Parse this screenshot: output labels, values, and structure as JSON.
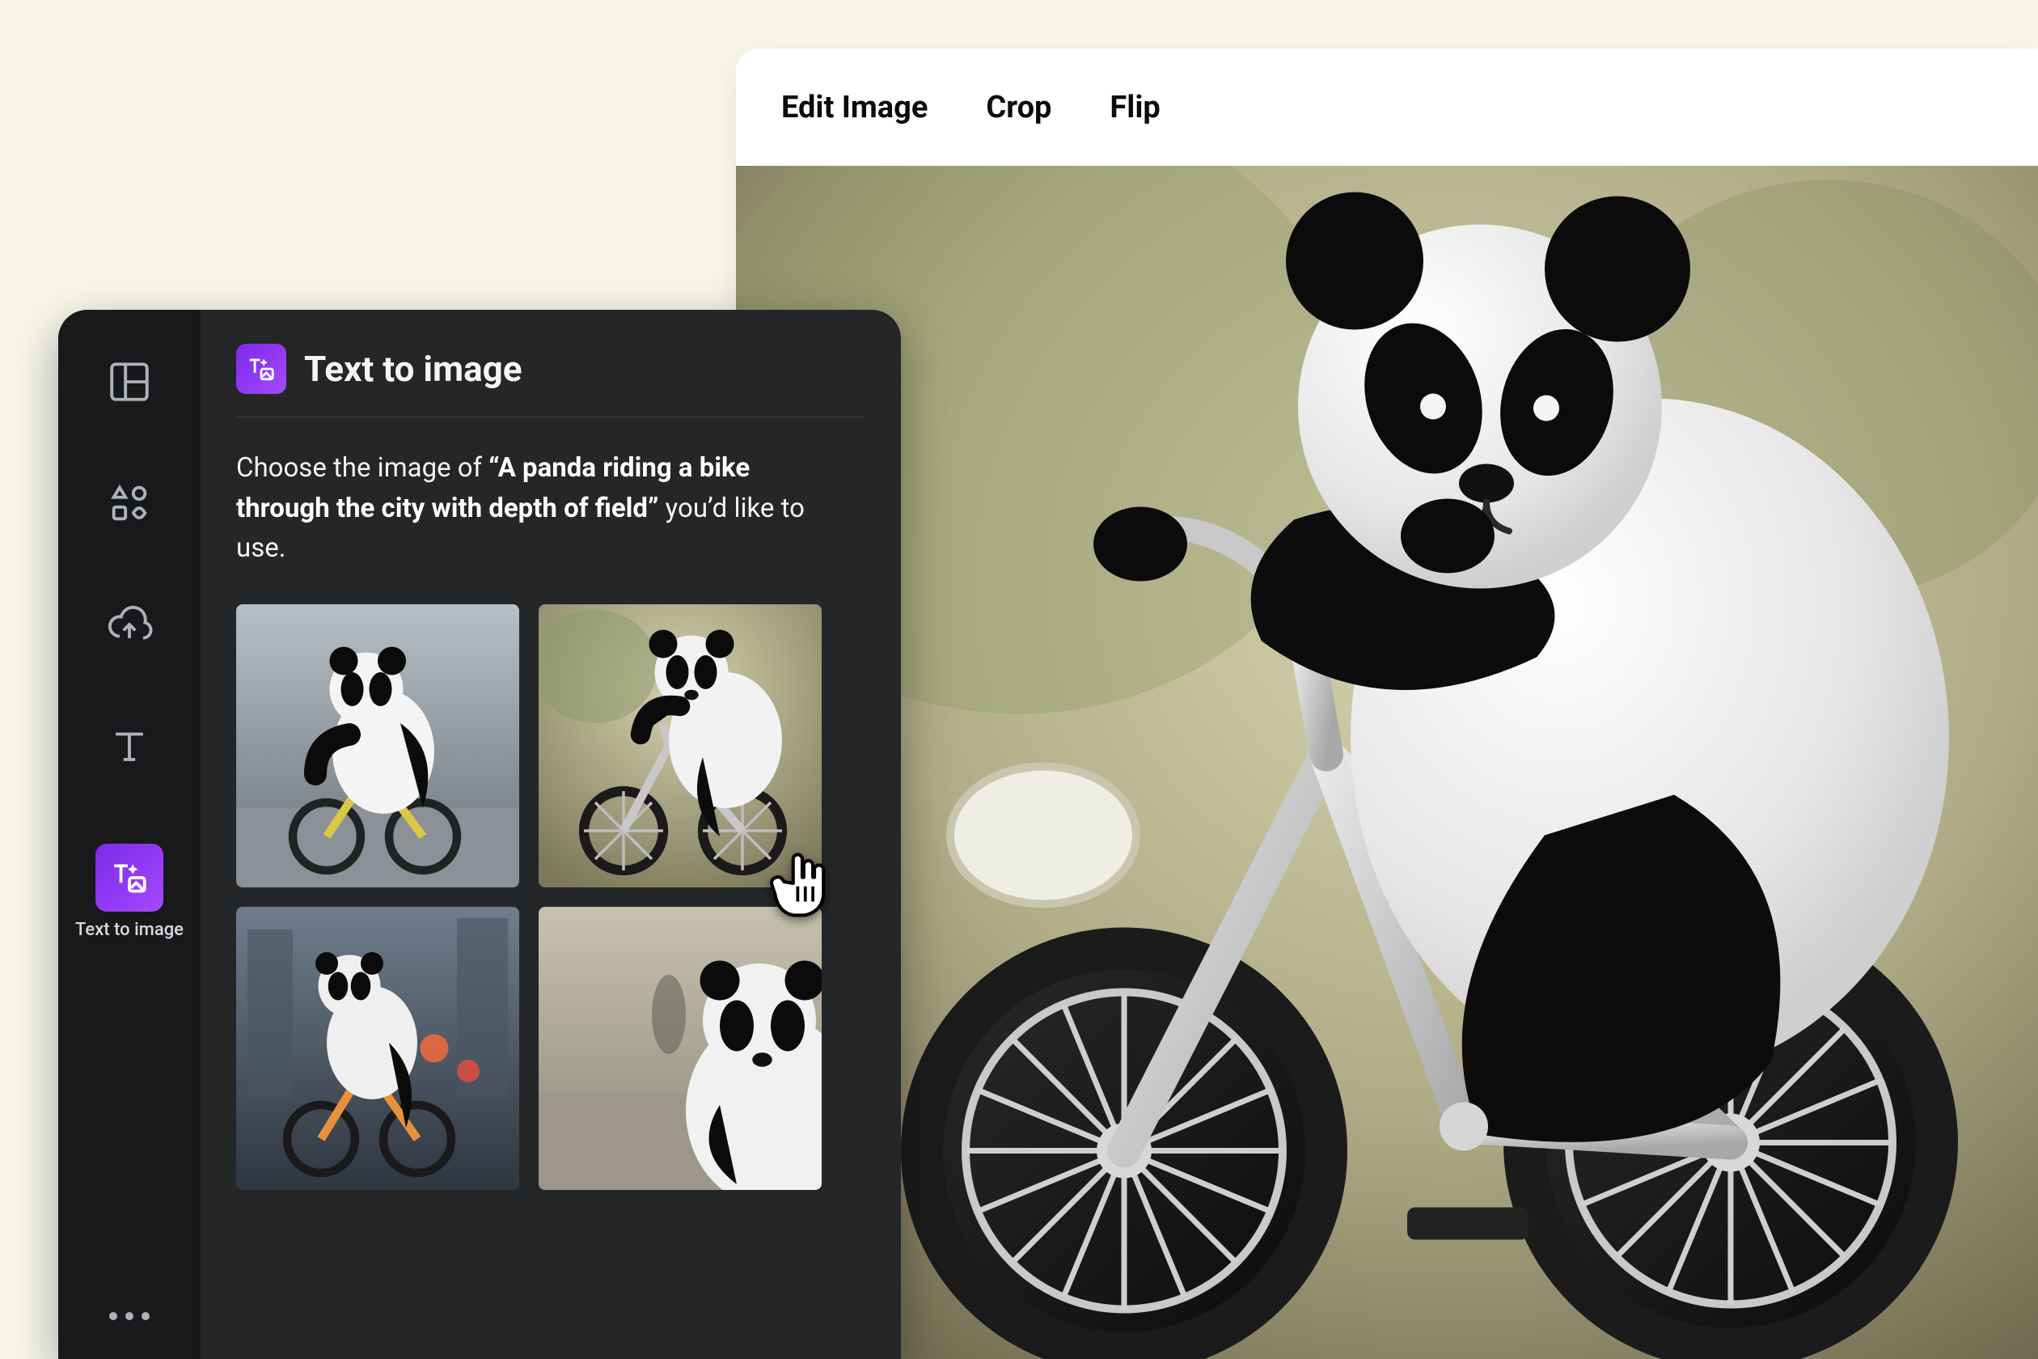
{
  "editor": {
    "tabs": {
      "edit": "Edit Image",
      "crop": "Crop",
      "flip": "Flip"
    },
    "canvas_alt": "Selected generated image of a panda riding a bike"
  },
  "panel": {
    "title": "Text to image",
    "prompt_prefix": "Choose the image of ",
    "prompt_quote_open": "“",
    "prompt_quote_text": "A panda riding a bike through the city with depth of field",
    "prompt_quote_close": "”",
    "prompt_suffix": " you’d like to use.",
    "thumb_alts": {
      "t1": "Panda on yellow bike, street",
      "t2": "Panda on silver bike, trees",
      "t3": "Panda on orange bike, city lights",
      "t4": "Panda close-up on street"
    }
  },
  "rail": {
    "templates": "Templates",
    "elements": "Elements",
    "uploads": "Uploads",
    "text": "Text",
    "text_to_image": "Text to image",
    "more": "More"
  }
}
